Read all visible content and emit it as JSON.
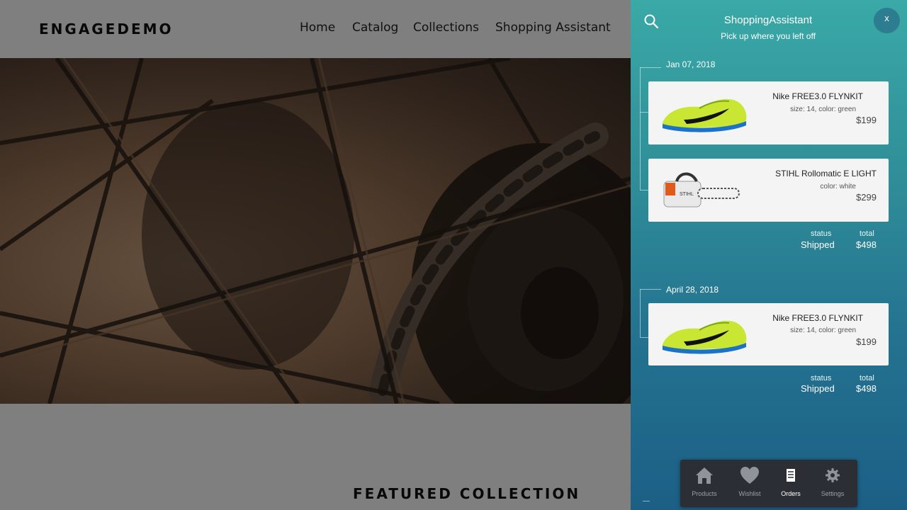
{
  "store": {
    "logo": "ENGAGEDEMO",
    "nav": [
      "Home",
      "Catalog",
      "Collections",
      "Shopping Assistant"
    ],
    "featured_heading": "FEATURED COLLECTION"
  },
  "assistant": {
    "title": "ShoppingAssistant",
    "subtitle": "Pick up where you left off",
    "close_label": "x",
    "orders": [
      {
        "date": "Jan 07, 2018",
        "items": [
          {
            "name": "Nike FREE3.0 FLYNKIT",
            "options": "size: 14, color: green",
            "price": "$199",
            "image_icon": "sneaker-icon"
          },
          {
            "name": "STIHL Rollomatic E LIGHT",
            "options": "color: white",
            "price": "$299",
            "image_icon": "chainsaw-icon"
          }
        ],
        "status_label": "status",
        "status": "Shipped",
        "total_label": "total",
        "total": "$498"
      },
      {
        "date": "April 28, 2018",
        "items": [
          {
            "name": "Nike FREE3.0 FLYNKIT",
            "options": "size: 14, color: green",
            "price": "$199",
            "image_icon": "sneaker-icon"
          }
        ],
        "status_label": "status",
        "status": "Shipped",
        "total_label": "total",
        "total": "$498"
      }
    ],
    "bottom_nav": [
      {
        "label": "Products",
        "icon": "home-icon"
      },
      {
        "label": "Wishlist",
        "icon": "heart-icon"
      },
      {
        "label": "Orders",
        "icon": "orders-icon",
        "active": true
      },
      {
        "label": "Settings",
        "icon": "gear-icon"
      }
    ]
  }
}
